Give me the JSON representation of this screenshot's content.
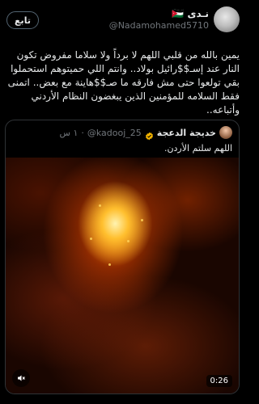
{
  "header": {
    "follow_label": "تابع",
    "display_name": "نـدى 🇯🇴",
    "handle": "@Nadamohamed5710"
  },
  "post": {
    "text": "يمين بالله من قلبي اللهم لا برداً ولا سلاما مفروض تكون النار عند إسـ$$رائيل بولاد.. وانتم اللي حميتوهم استحملوا بقي تولعوا حتى مش فارقه ما صـ$$هاينة مع بعض.. اتمنى فقط السلامه للمؤمنين الذين يبغضون النظام الأردني وأتباعه.."
  },
  "quote": {
    "name": "خديجة الدعجة",
    "handle": "@kadooj_25",
    "dot": "·",
    "time": "١ س",
    "text": "اللهم سلتم الأردن.",
    "video": {
      "duration": "0:26"
    }
  },
  "colors": {
    "background": "#000000",
    "text": "#e7e9ea",
    "muted": "#71767b",
    "border": "#2f3336",
    "verified": "#f4b400"
  },
  "icons": {
    "verified": "verified-badge-icon",
    "mute": "speaker-muted-icon"
  }
}
